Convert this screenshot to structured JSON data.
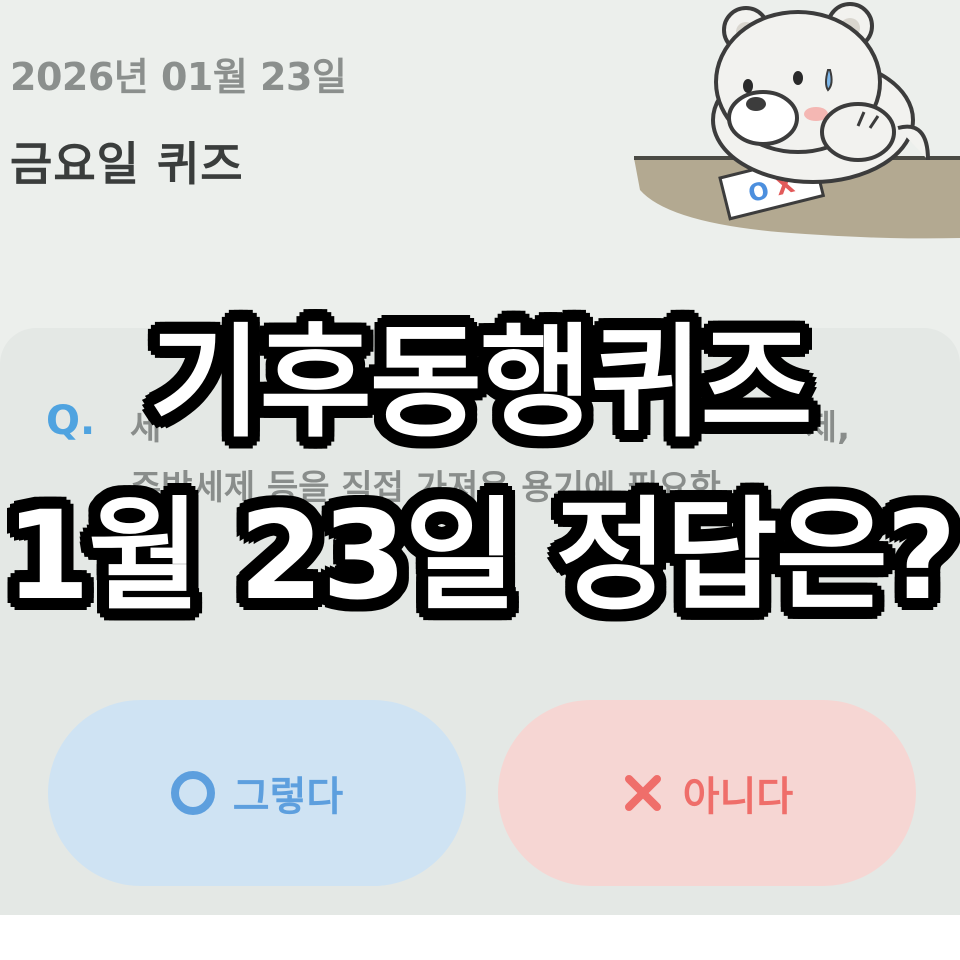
{
  "header": {
    "date": "2026년 01월 23일",
    "title": "금요일 퀴즈"
  },
  "mascot": {
    "icon": "polar-bear-mascot",
    "card_text": "OX"
  },
  "quiz": {
    "q_label": "Q.",
    "question_line1": "세",
    "question_line1_end": "제,",
    "question_line2": "주방세제 등을 직접 가져온 용기에 필요한",
    "question_line3": "만"
  },
  "answers": {
    "yes": {
      "icon": "circle-icon",
      "label": "그렇다",
      "color": "#5d9fde"
    },
    "no": {
      "icon": "x-icon",
      "label": "아니다",
      "color": "#ef6e6a"
    }
  },
  "overlay": {
    "line1": "기후동행퀴즈",
    "line2": "1월 23일 정답은?"
  }
}
